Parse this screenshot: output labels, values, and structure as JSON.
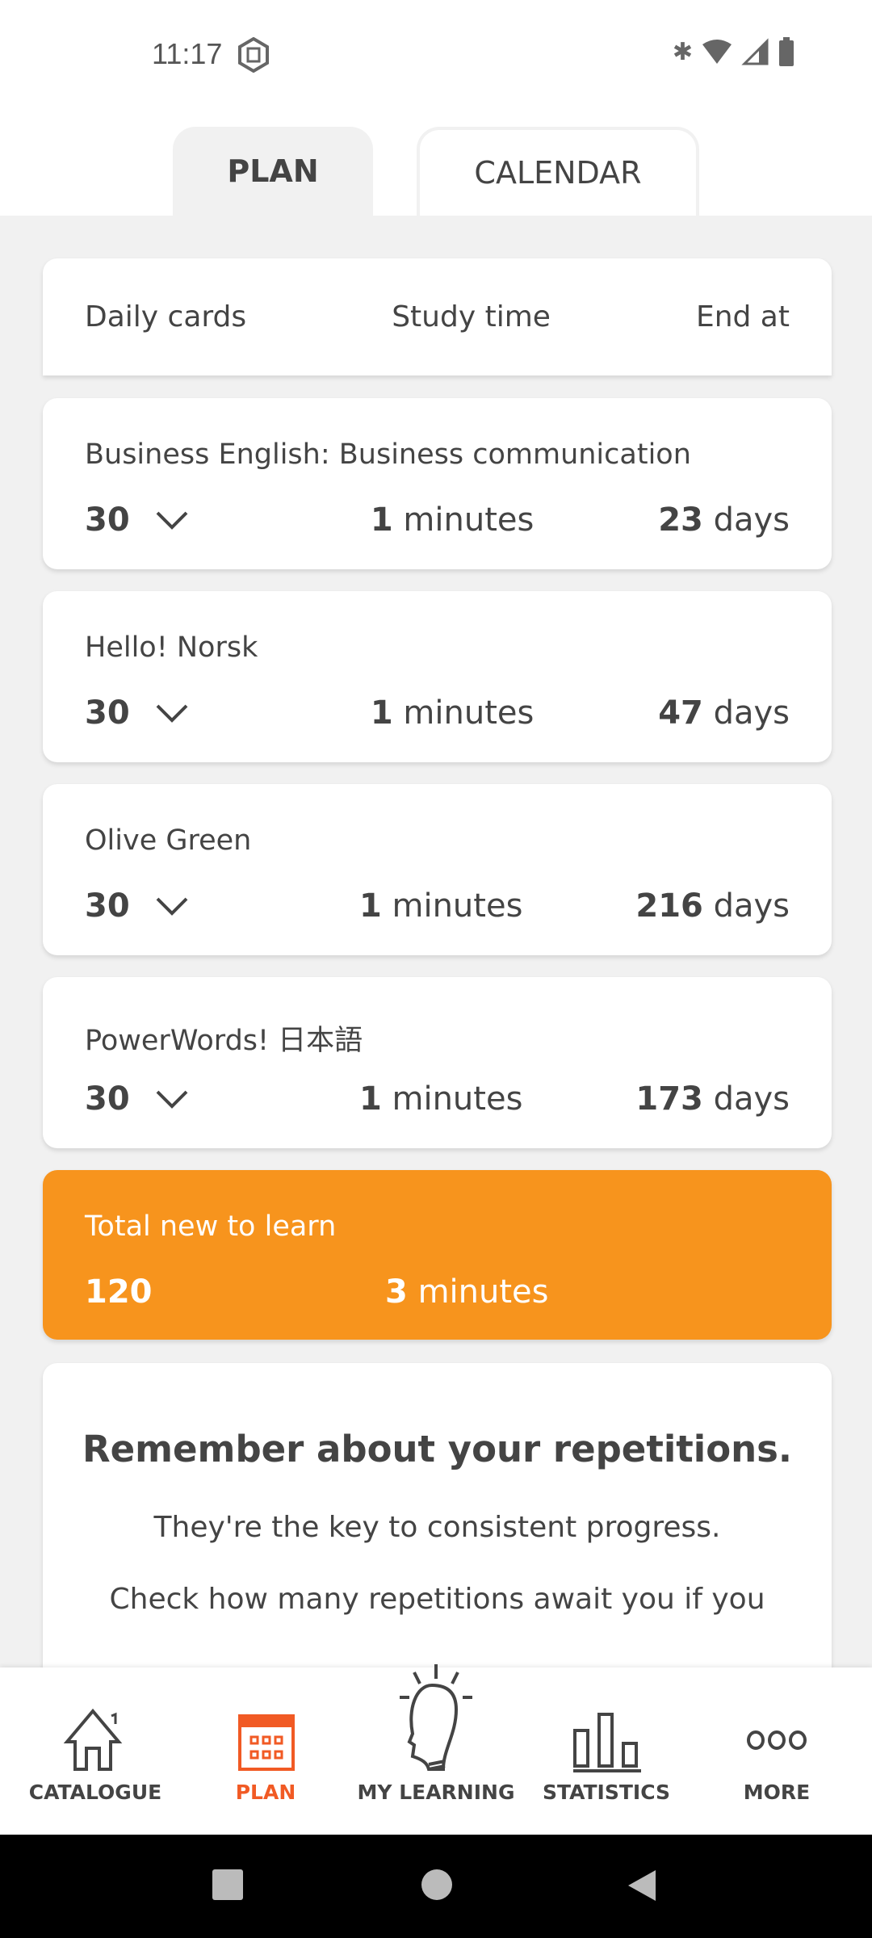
{
  "status": {
    "time": "11:17",
    "icons": [
      "vpn-shield-icon",
      "bluetooth-icon",
      "wifi-icon",
      "signal-hd-icon",
      "battery-icon"
    ]
  },
  "tabs": [
    {
      "label": "PLAN",
      "active": true
    },
    {
      "label": "CALENDAR",
      "active": false
    }
  ],
  "header": {
    "daily": "Daily cards",
    "study": "Study time",
    "end": "End at"
  },
  "courses": [
    {
      "title": "Business English: Business communication",
      "cards": "30",
      "minutes": "1",
      "minutes_unit": "minutes",
      "days": "23",
      "days_unit": "days"
    },
    {
      "title": "Hello! Norsk",
      "cards": "30",
      "minutes": "1",
      "minutes_unit": "minutes",
      "days": "47",
      "days_unit": "days"
    },
    {
      "title": "Olive Green",
      "cards": "30",
      "minutes": "1",
      "minutes_unit": "minutes",
      "days": "216",
      "days_unit": "days"
    },
    {
      "title": "PowerWords! 日本語",
      "cards": "30",
      "minutes": "1",
      "minutes_unit": "minutes",
      "days": "173",
      "days_unit": "days"
    }
  ],
  "total": {
    "title": "Total new to learn",
    "cards": "120",
    "minutes": "3",
    "minutes_unit": "minutes",
    "color": "#f7941d"
  },
  "reminder": {
    "title": "Remember about your repetitions.",
    "line1": "They're the key to consistent progress.",
    "line2": "Check how many repetitions await you if you"
  },
  "nav": [
    {
      "label": "CATALOGUE",
      "icon": "house-icon"
    },
    {
      "label": "PLAN",
      "icon": "calendar-icon",
      "active": true
    },
    {
      "label": "MY LEARNING",
      "icon": "lightbulb-head-icon"
    },
    {
      "label": "STATISTICS",
      "icon": "bar-chart-icon"
    },
    {
      "label": "MORE",
      "icon": "more-icon"
    }
  ],
  "accent": "#f15a24"
}
